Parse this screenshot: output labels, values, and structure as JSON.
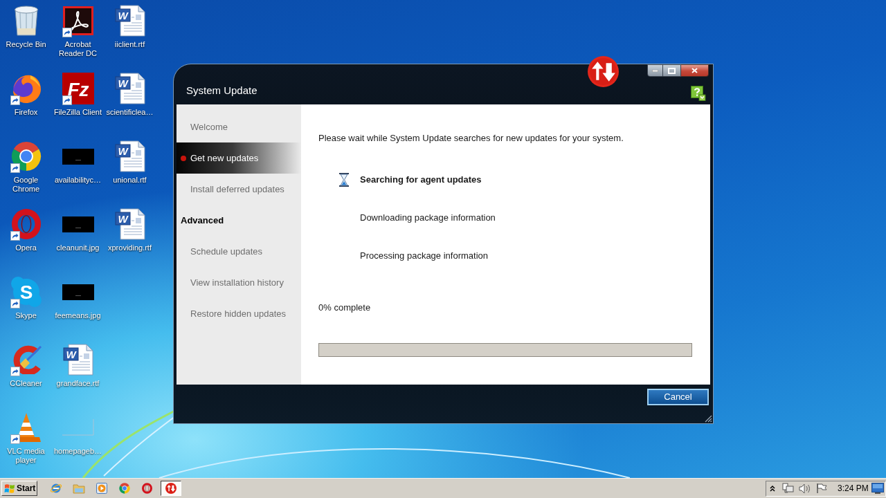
{
  "desktop": {
    "icons": [
      {
        "label": "Recycle Bin",
        "kind": "bin",
        "shortcut": false
      },
      {
        "label": "Firefox",
        "kind": "foxglobe",
        "shortcut": true
      },
      {
        "label": "Google Chrome",
        "kind": "ring",
        "shortcut": true
      },
      {
        "label": "Opera",
        "kind": "ocircle",
        "shortcut": true
      },
      {
        "label": "Skype",
        "kind": "scloud",
        "glyph": "S",
        "shortcut": true
      },
      {
        "label": "CCleaner",
        "kind": "cbrush",
        "shortcut": true
      },
      {
        "label": "VLC media player",
        "kind": "cone",
        "shortcut": true
      },
      {
        "label": "Acrobat Reader DC",
        "kind": "swoosh",
        "shortcut": true
      },
      {
        "label": "FileZilla Client",
        "kind": "tile",
        "glyph": "Fz",
        "shortcut": true
      },
      {
        "label": "availabilityc…",
        "kind": "thumbnail",
        "shortcut": false
      },
      {
        "label": "cleanunit.jpg",
        "kind": "thumbnail",
        "shortcut": false
      },
      {
        "label": "feemeans.jpg",
        "kind": "thumbnail",
        "shortcut": false
      },
      {
        "label": "grandface.rtf",
        "kind": "document",
        "glyph": "W",
        "shortcut": false
      },
      {
        "label": "homepageb…",
        "kind": "outline",
        "shortcut": false
      },
      {
        "label": "iiclient.rtf",
        "kind": "document",
        "glyph": "W",
        "shortcut": false
      },
      {
        "label": "scientificlea…",
        "kind": "document",
        "glyph": "W",
        "shortcut": false
      },
      {
        "label": "unional.rtf",
        "kind": "document",
        "glyph": "W",
        "shortcut": false
      },
      {
        "label": "xproviding.rtf",
        "kind": "document",
        "glyph": "W",
        "shortcut": false
      }
    ]
  },
  "window": {
    "title": "System Update",
    "sidebar": {
      "items": [
        {
          "label": "Welcome",
          "kind": "link",
          "selected": false
        },
        {
          "label": "Get new updates",
          "kind": "link",
          "selected": true
        },
        {
          "label": "Install deferred updates",
          "kind": "link",
          "selected": false
        },
        {
          "label": "Advanced",
          "kind": "heading",
          "selected": false
        },
        {
          "label": "Schedule updates",
          "kind": "link",
          "selected": false
        },
        {
          "label": "View installation history",
          "kind": "link",
          "selected": false
        },
        {
          "label": "Restore hidden updates",
          "kind": "link",
          "selected": false
        }
      ]
    },
    "message": "Please wait while System Update searches for new updates for your system.",
    "steps": [
      {
        "label": "Searching for agent updates",
        "active": true
      },
      {
        "label": "Downloading package information",
        "active": false
      },
      {
        "label": "Processing package information",
        "active": false
      }
    ],
    "progress": {
      "reading": "0% complete",
      "level": 0
    },
    "buttons": [
      "Cancel"
    ]
  },
  "taskbar": {
    "start": "Start",
    "items": [
      {
        "kind": "orbit",
        "selected": false
      },
      {
        "kind": "folder",
        "selected": false
      },
      {
        "kind": "player",
        "selected": false
      },
      {
        "kind": "ring",
        "selected": false
      },
      {
        "kind": "ocircle",
        "selected": false
      },
      {
        "kind": "updown",
        "selected": true
      }
    ],
    "clock": "3:24 PM"
  }
}
